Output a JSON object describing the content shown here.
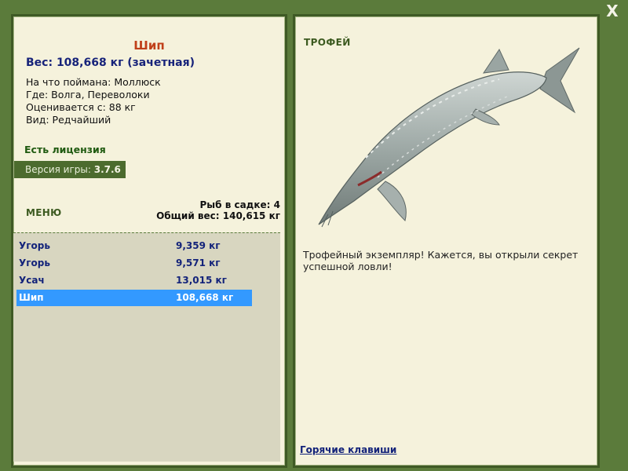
{
  "window": {
    "close_label": "X"
  },
  "fish": {
    "name": "Шип",
    "weight_line": "Вес: 108,668 кг (зачетная)",
    "caught_on": "На что поймана: Моллюск",
    "location": "Где: Волга, Переволоки",
    "valued_from": "Оценивается с: 88 кг",
    "rarity": "Вид: Редчайший"
  },
  "license": "Есть лицензия",
  "version": {
    "label": "Версия игры:",
    "value": "3.7.6"
  },
  "menu_label": "МЕНЮ",
  "creel": {
    "count_line": "Рыб в садке: 4",
    "total_line": "Общий вес: 140,615 кг"
  },
  "catch_list": [
    {
      "name": "Угорь",
      "weight": "9,359 кг",
      "selected": false
    },
    {
      "name": "Угорь",
      "weight": "9,571 кг",
      "selected": false
    },
    {
      "name": "Усач",
      "weight": "13,015 кг",
      "selected": false
    },
    {
      "name": "Шип",
      "weight": "108,668 кг",
      "selected": true
    }
  ],
  "trophy": {
    "label": "ТРОФЕЙ",
    "description": "Трофейный экземпляр! Кажется, вы открыли секрет успешной ловли!",
    "hotkeys_link": "Горячие клавиши"
  },
  "colors": {
    "frame": "#5b7b3b",
    "panel": "#f5f2dc",
    "selection": "#3399ff",
    "title": "#c0401a"
  }
}
